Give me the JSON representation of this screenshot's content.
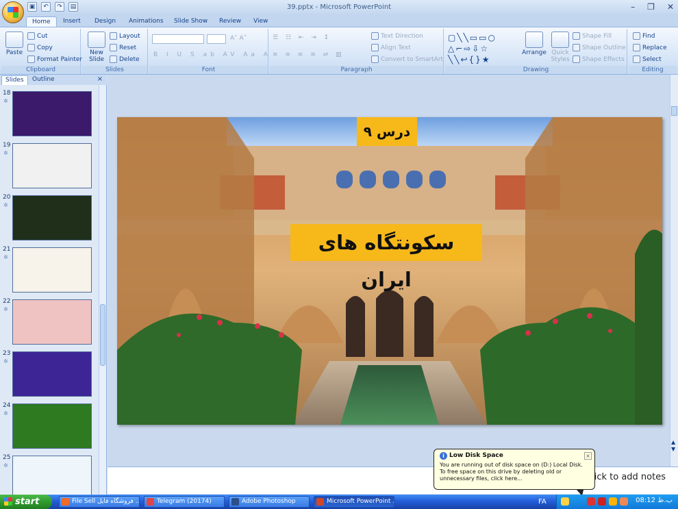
{
  "window": {
    "title": "39.pptx - Microsoft PowerPoint"
  },
  "ribbon_tabs": [
    "Home",
    "Insert",
    "Design",
    "Animations",
    "Slide Show",
    "Review",
    "View"
  ],
  "clipboard": {
    "paste": "Paste",
    "cut": "Cut",
    "copy": "Copy",
    "format_painter": "Format Painter",
    "label": "Clipboard"
  },
  "slides_group": {
    "new_slide": "New Slide",
    "layout": "Layout",
    "reset": "Reset",
    "delete": "Delete",
    "label": "Slides"
  },
  "font_group": {
    "label": "Font"
  },
  "paragraph_group": {
    "text_direction": "Text Direction",
    "align_text": "Align Text",
    "convert_smartart": "Convert to SmartArt",
    "label": "Paragraph"
  },
  "drawing_group": {
    "arrange": "Arrange",
    "quick_styles": "Quick Styles",
    "shape_fill": "Shape Fill",
    "shape_outline": "Shape Outline",
    "shape_effects": "Shape Effects",
    "label": "Drawing"
  },
  "editing_group": {
    "find": "Find",
    "replace": "Replace",
    "select": "Select",
    "label": "Editing"
  },
  "pane_tabs": {
    "slides": "Slides",
    "outline": "Outline"
  },
  "thumbnails": [
    {
      "num": "18",
      "bg": "#3b1a6b"
    },
    {
      "num": "19",
      "bg": "#f1f1f1"
    },
    {
      "num": "20",
      "bg": "#1f2f1a"
    },
    {
      "num": "21",
      "bg": "#f7f3ea"
    },
    {
      "num": "22",
      "bg": "#f0c3c3"
    },
    {
      "num": "23",
      "bg": "#3d2596"
    },
    {
      "num": "24",
      "bg": "#2e7a21"
    },
    {
      "num": "25",
      "bg": "#eef6fb"
    }
  ],
  "slide": {
    "lesson": "درس ۹",
    "title": "سکونتگاه های ایران"
  },
  "notes": {
    "placeholder": "Click to add notes"
  },
  "balloon": {
    "title": "Low Disk Space",
    "text": "You are running out of disk space on (D:) Local Disk. To free space on this drive by deleting old or unnecessary files, click here..."
  },
  "taskbar": {
    "start": "start",
    "buttons": [
      "File Sell فروشگاه فایل ...",
      "Telegram (20174)",
      "Adobe Photoshop",
      "Microsoft PowerPoint ..."
    ],
    "lang": "FA",
    "clock": "08:12 ب.ظ"
  }
}
